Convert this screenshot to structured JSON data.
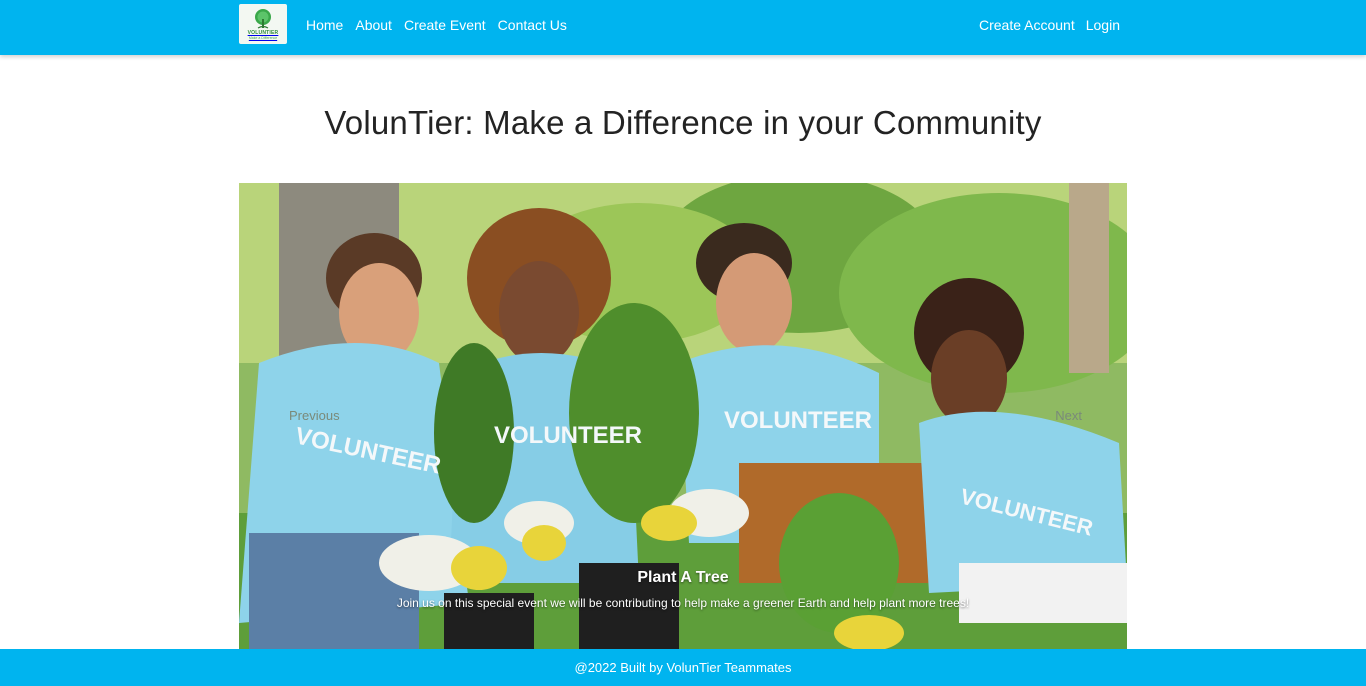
{
  "brand": {
    "logo_text": "VOLUNTIER",
    "logo_tagline": "Make a Difference",
    "colors": {
      "nav_bg": "#00b4ef",
      "footer_bg": "#00b4ef",
      "logo_green": "#2e8b3a"
    }
  },
  "nav": {
    "links": [
      "Home",
      "About",
      "Create Event",
      "Contact Us"
    ],
    "right": [
      "Create Account",
      "Login"
    ]
  },
  "page": {
    "title": "VolunTier: Make a Difference in your Community"
  },
  "carousel": {
    "prev_label": "Previous",
    "next_label": "Next",
    "slide": {
      "image": "volunteers-planting-trees-photo",
      "caption_title": "Plant A Tree",
      "caption_text": "Join us on this special event we will be contributing to help make a greener Earth and help plant more trees!",
      "shirt_text": "VOLUNTEER"
    }
  },
  "footer": {
    "text": "@2022 Built by VolunTier Teammates"
  }
}
